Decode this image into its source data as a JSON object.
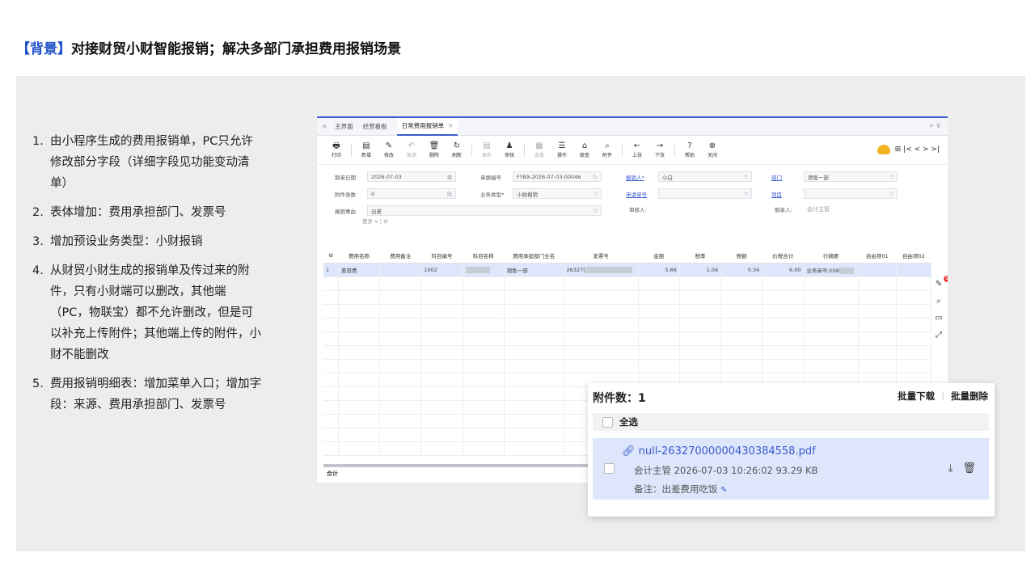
{
  "heading": {
    "tag": "【背景】",
    "text": "对接财贸小财智能报销；解决多部门承担费用报销场景"
  },
  "notes": [
    {
      "num": "1.",
      "text": "由小程序生成的费用报销单，PC只允许修改部分字段（详细字段见功能变动清单）"
    },
    {
      "num": "2.",
      "text": "表体增加：费用承担部门、发票号"
    },
    {
      "num": "3.",
      "text": "增加预设业务类型：小财报销"
    },
    {
      "num": "4.",
      "text": "从财贸小财生成的报销单及传过来的附件，只有小财端可以删改，其他端（PC，物联宝）都不允许删改，但是可以补充上传附件；其他端上传的附件，小财不能删改"
    },
    {
      "num": "5.",
      "text": "费用报销明细表：增加菜单入口；增加字段：来源、费用承担部门、发票号"
    }
  ],
  "erp": {
    "tabs": {
      "collapse": "«",
      "home": "主界面",
      "board": "经营看板",
      "active": "日常费用报销单",
      "close": "×",
      "right": "»  ∨"
    },
    "toolbar": [
      {
        "icon": "🖶",
        "label": "打印"
      },
      {
        "icon": "▤",
        "label": "新增"
      },
      {
        "icon": "✎",
        "label": "修改"
      },
      {
        "icon": "↶",
        "label": "取消"
      },
      {
        "icon": "🗑",
        "label": "删除"
      },
      {
        "icon": "↻",
        "label": "刷新"
      },
      {
        "icon": "▤",
        "label": "保存"
      },
      {
        "icon": "♟",
        "label": "审核"
      },
      {
        "icon": "▦",
        "label": "选单"
      },
      {
        "icon": "☰",
        "label": "操作"
      },
      {
        "icon": "⌂",
        "label": "联查"
      },
      {
        "icon": "⌕",
        "label": "附件"
      },
      {
        "icon": "←",
        "label": "上张"
      },
      {
        "icon": "→",
        "label": "下张"
      },
      {
        "icon": "?",
        "label": "帮助"
      },
      {
        "icon": "⊗",
        "label": "关闭"
      }
    ],
    "nav": "⊞  |<  <  >  >|",
    "form": {
      "date_label": "制单日期",
      "date_value": "2026-07-03",
      "docno_label": "单据编号",
      "docno_value": "FYBX-2026-07-03-00046",
      "claimant_label": "报销人*",
      "claimant_value": "小白",
      "dept_label": "部门",
      "dept_value": "销售一部",
      "attach_label": "附件张数",
      "attach_value": "0",
      "bizType_label": "业务类型*",
      "bizType_value": "小财报销",
      "apply_label": "申请单号",
      "apply_value": "",
      "project_label": "项目",
      "project_value": "",
      "reason_label": "报销事由",
      "reason_value": "出差",
      "auditor_label": "审核人:",
      "auditor_value": "",
      "maker_label": "制单人:",
      "maker_value": "会计主管",
      "more": "更多 ∨  |  ⚙"
    },
    "table": {
      "headers": [
        "",
        "费用名称",
        "费用备注",
        "科目编号",
        "科目名称",
        "费用承担部门全名",
        "发票号",
        "金额",
        "税率",
        "税额",
        "价税合计",
        "行摘要",
        "自由项01",
        "自由项02"
      ],
      "row": {
        "no": "1",
        "name": "差旅费",
        "remark": "",
        "code": "1002",
        "dept": "销售一部",
        "invoice": "26327(",
        "amount": "5.66",
        "rate": "1.06",
        "tax": "0.34",
        "total": "6.00",
        "summary": "业务单号:EIW"
      },
      "sum_label": "合计"
    }
  },
  "popup": {
    "title": "附件数：1",
    "batch_download": "批量下载",
    "batch_delete": "批量删除",
    "select_all": "全选",
    "file": {
      "name": "null-26327000000430384558.pdf",
      "meta": "会计主管   2026-07-03 10:26:02   93.29 KB",
      "note": "备注：出差费用吃饭"
    }
  },
  "colors": {
    "accent": "#3a5bd0",
    "tag": "#1e52c8",
    "panel": "#ededed",
    "highlight": "#dde6fa"
  }
}
